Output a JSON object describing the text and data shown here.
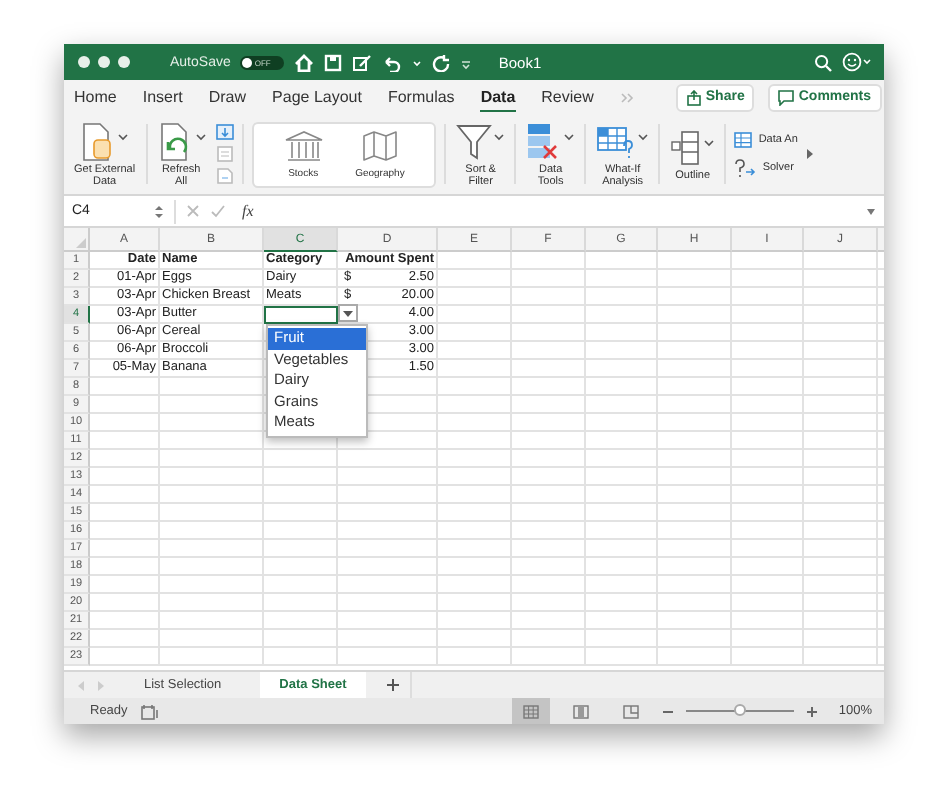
{
  "window": {
    "title": "Book1",
    "autosave_label": "AutoSave",
    "autosave_state": "OFF",
    "autosave_on": false
  },
  "ribbon_tabs": [
    {
      "label": "Home",
      "selected": false
    },
    {
      "label": "Insert",
      "selected": false
    },
    {
      "label": "Draw",
      "selected": false
    },
    {
      "label": "Page Layout",
      "selected": false
    },
    {
      "label": "Formulas",
      "selected": false
    },
    {
      "label": "Data",
      "selected": true
    },
    {
      "label": "Review",
      "selected": false
    }
  ],
  "share": "Share",
  "comments": "Comments",
  "ribbon_groups": [
    {
      "kind": "get-data",
      "label": "Get External\nData",
      "caret": true
    },
    {
      "kind": "refresh",
      "label": "Refresh\nAll",
      "caret": true
    },
    {
      "kind": "small-stack"
    },
    {
      "kind": "data-types",
      "items": [
        {
          "kind": "stocks",
          "label": "Stocks"
        },
        {
          "kind": "geography",
          "label": "Geography"
        }
      ]
    },
    {
      "kind": "sort-filter",
      "label": "Sort &\nFilter",
      "caret": true
    },
    {
      "kind": "data-tools",
      "label": "Data\nTools",
      "caret": true
    },
    {
      "kind": "what-if",
      "label": "What-If\nAnalysis",
      "caret": true
    },
    {
      "kind": "outline",
      "label": "Outline",
      "caret": true
    },
    {
      "kind": "analysis",
      "items": [
        {
          "kind": "data-analysis",
          "label": "Data An"
        },
        {
          "kind": "solver",
          "label": "Solver"
        }
      ]
    }
  ],
  "formula_bar": {
    "name_box": "C4",
    "function_label": "fx"
  },
  "columns": [
    {
      "label": "A",
      "selected": false
    },
    {
      "label": "B",
      "selected": false
    },
    {
      "label": "C",
      "selected": true
    },
    {
      "label": "D",
      "selected": false
    },
    {
      "label": "E",
      "selected": false
    },
    {
      "label": "F",
      "selected": false
    },
    {
      "label": "G",
      "selected": false
    },
    {
      "label": "H",
      "selected": false
    },
    {
      "label": "I",
      "selected": false
    },
    {
      "label": "J",
      "selected": false
    }
  ],
  "rows": [
    {
      "number": "1",
      "kind": "header",
      "selected": false,
      "date": "Date",
      "name": "Name",
      "category": "Category",
      "amount": "Amount Spent"
    },
    {
      "number": "2",
      "kind": "data",
      "selected": false,
      "date": "01-Apr",
      "name": "Eggs",
      "category": "Dairy",
      "currency": "$",
      "amount": "2.50"
    },
    {
      "number": "3",
      "kind": "data",
      "selected": false,
      "date": "03-Apr",
      "name": "Chicken Breast",
      "category": "Meats",
      "currency": "$",
      "amount": "20.00"
    },
    {
      "number": "4",
      "kind": "data",
      "selected": true,
      "date": "03-Apr",
      "name": "Butter",
      "amount": "4.00"
    },
    {
      "number": "5",
      "kind": "data",
      "selected": false,
      "date": "06-Apr",
      "name": "Cereal",
      "amount": "3.00"
    },
    {
      "number": "6",
      "kind": "data",
      "selected": false,
      "date": "06-Apr",
      "name": "Broccoli",
      "amount": "3.00"
    },
    {
      "number": "7",
      "kind": "data",
      "selected": false,
      "date": "05-May",
      "name": "Banana",
      "amount": "1.50"
    },
    {
      "number": "8",
      "selected": false
    },
    {
      "number": "9",
      "selected": false
    },
    {
      "number": "10",
      "selected": false
    },
    {
      "number": "11",
      "selected": false
    },
    {
      "number": "12",
      "selected": false
    },
    {
      "number": "13",
      "selected": false
    },
    {
      "number": "14",
      "selected": false
    },
    {
      "number": "15",
      "selected": false
    },
    {
      "number": "16",
      "selected": false
    },
    {
      "number": "17",
      "selected": false
    },
    {
      "number": "18",
      "selected": false
    },
    {
      "number": "19",
      "selected": false
    },
    {
      "number": "20",
      "selected": false
    },
    {
      "number": "21",
      "selected": false
    },
    {
      "number": "22",
      "selected": false
    },
    {
      "number": "23",
      "selected": false
    }
  ],
  "dropdown": {
    "options": [
      {
        "label": "Fruit",
        "selected": true
      },
      {
        "label": "Vegetables",
        "selected": false
      },
      {
        "label": "Dairy",
        "selected": false
      },
      {
        "label": "Grains",
        "selected": false
      },
      {
        "label": "Meats",
        "selected": false
      }
    ]
  },
  "sheet_tabs": [
    {
      "label": "List Selection",
      "selected": false
    },
    {
      "label": "Data Sheet",
      "selected": true
    }
  ],
  "status_bar": {
    "text": "Ready",
    "views": [
      {
        "kind": "normal",
        "selected": true
      },
      {
        "kind": "page-layout",
        "selected": false
      },
      {
        "kind": "page-break",
        "selected": false
      }
    ],
    "zoom_slider": {
      "level": 0.5
    },
    "zoom": "100%"
  }
}
